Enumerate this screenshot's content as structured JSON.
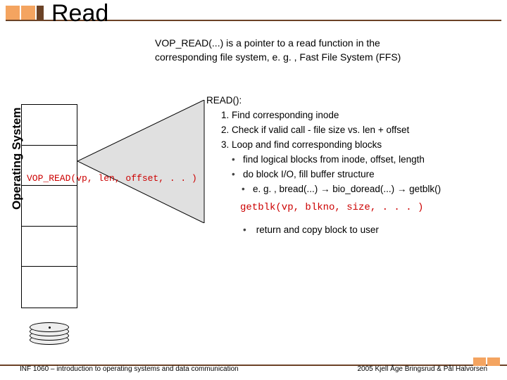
{
  "title": "Read",
  "sidebar_label": "Operating System",
  "intro": {
    "line1": "VOP_READ(...) is a pointer to a read function in the",
    "line2": "corresponding file system, e. g. , Fast File System (FFS)"
  },
  "vop_code": "VOP_READ(vp, len, offset, . . )",
  "read_header": "READ():",
  "steps": {
    "s1": "Find corresponding inode",
    "s2": "Check if valid call - file size vs. len + offset",
    "s3": "Loop and find corresponding blocks"
  },
  "bullets": {
    "b1": "find logical blocks from inode, offset, length",
    "b2": "do block I/O, fill buffer structure",
    "b3": "e. g. , bread(...) → bio_doread(...) → getblk()"
  },
  "getblk": "getblk(vp, blkno, size, . . . )",
  "return_item": "return and copy block to user",
  "footer": {
    "left": "INF 1060 – introduction to operating systems and data communication",
    "right": "2005 Kjell Åge Bringsrud & Pål Halvorsen"
  }
}
